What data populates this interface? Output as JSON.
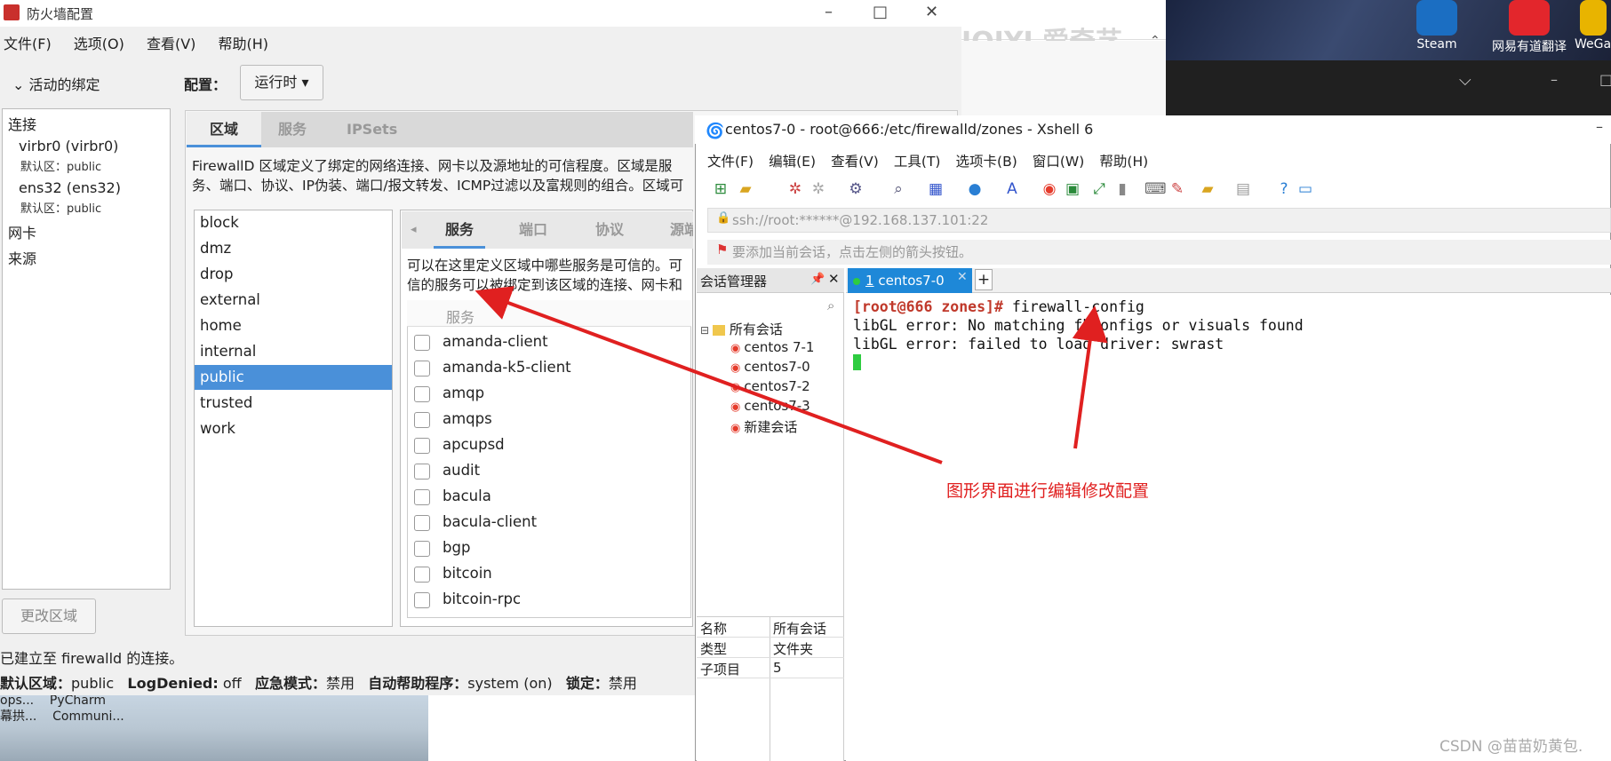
{
  "background": {
    "desktop_icons": [
      {
        "label": "Steam",
        "color": "#1b6ec2"
      },
      {
        "label": "网易有道翻译",
        "color": "#e3262c"
      },
      {
        "label": "WeGa",
        "color": "#e8b400"
      }
    ],
    "taskbar_labels": "ops...    PyCharm\n幕拱...    Communi...",
    "watermark_text": "IQIYI 爱奇艺"
  },
  "firewall": {
    "title": "防火墙配置",
    "menu": [
      "文件(F)",
      "选项(O)",
      "查看(V)",
      "帮助(H)"
    ],
    "active_bindings": "活动的绑定",
    "connections_header": "连接",
    "connections": [
      {
        "name": "virbr0 (virbr0)",
        "zone": "默认区：public"
      },
      {
        "name": "ens32 (ens32)",
        "zone": "默认区：public"
      }
    ],
    "nic_label": "网卡",
    "source_label": "来源",
    "change_zone": "更改区域",
    "config_label": "配置：",
    "config_value": "运行时",
    "tabs": [
      "区域",
      "服务",
      "IPSets"
    ],
    "zone_description": "FirewallD 区域定义了绑定的网络连接、网卡以及源地址的可信程度。区域是服务、端口、协议、IP伪装、端口/报文转发、ICMP过滤以及富规则的组合。区域可以绑定到网卡以及源地址。",
    "zones": [
      "block",
      "dmz",
      "drop",
      "external",
      "home",
      "internal",
      "public",
      "trusted",
      "work"
    ],
    "selected_zone": "public",
    "sub_tabs": [
      "服务",
      "端口",
      "协议",
      "源端"
    ],
    "services_description": "可以在这里定义区域中哪些服务是可信的。可信的服务可以被绑定到该区域的连接、网卡和源的所有主机和网络及可以访问可信服务。",
    "services_header": "服务",
    "services": [
      "amanda-client",
      "amanda-k5-client",
      "amqp",
      "amqps",
      "apcupsd",
      "audit",
      "bacula",
      "bacula-client",
      "bgp",
      "bitcoin",
      "bitcoin-rpc"
    ],
    "status_line": "已建立至 firewalld 的连接。",
    "status": {
      "default_zone_label": "默认区域：",
      "default_zone": "public",
      "log_denied_label": "LogDenied:",
      "log_denied": "off",
      "panic_label": "应急模式：",
      "panic": "禁用",
      "helper_label": "自动帮助程序：",
      "helper": "system (on)",
      "lock_label": "锁定：",
      "lock": "禁用"
    }
  },
  "xshell": {
    "title": "centos7-0 - root@666:/etc/firewalld/zones - Xshell 6",
    "menu": [
      "文件(F)",
      "编辑(E)",
      "查看(V)",
      "工具(T)",
      "选项卡(B)",
      "窗口(W)",
      "帮助(H)"
    ],
    "address": "ssh://root:******@192.168.137.101:22",
    "hint": "要添加当前会话，点击左侧的箭头按钮。",
    "session_manager": "会话管理器",
    "all_sessions": "所有会话",
    "sessions": [
      "centos 7-1",
      "centos7-0",
      "centos7-2",
      "centos7-3",
      "新建会话"
    ],
    "properties": [
      {
        "key": "名称",
        "value": "所有会话"
      },
      {
        "key": "类型",
        "value": "文件夹"
      },
      {
        "key": "子项目",
        "value": "5"
      }
    ],
    "tab_index": "1",
    "tab_name": "centos7-0",
    "terminal": {
      "prompt": "[root@666 zones]#",
      "command": " firewall-config",
      "lines": [
        "libGL error: No matching fbConfigs or visuals found",
        "libGL error: failed to load driver: swrast"
      ]
    }
  },
  "annotation": "图形界面进行编辑修改配置",
  "watermark": "CSDN @苗苗奶黄包.",
  "colors": {
    "accent": "#4a90d9",
    "arrow": "#e02020",
    "xshell_tab": "#1e88d8"
  }
}
